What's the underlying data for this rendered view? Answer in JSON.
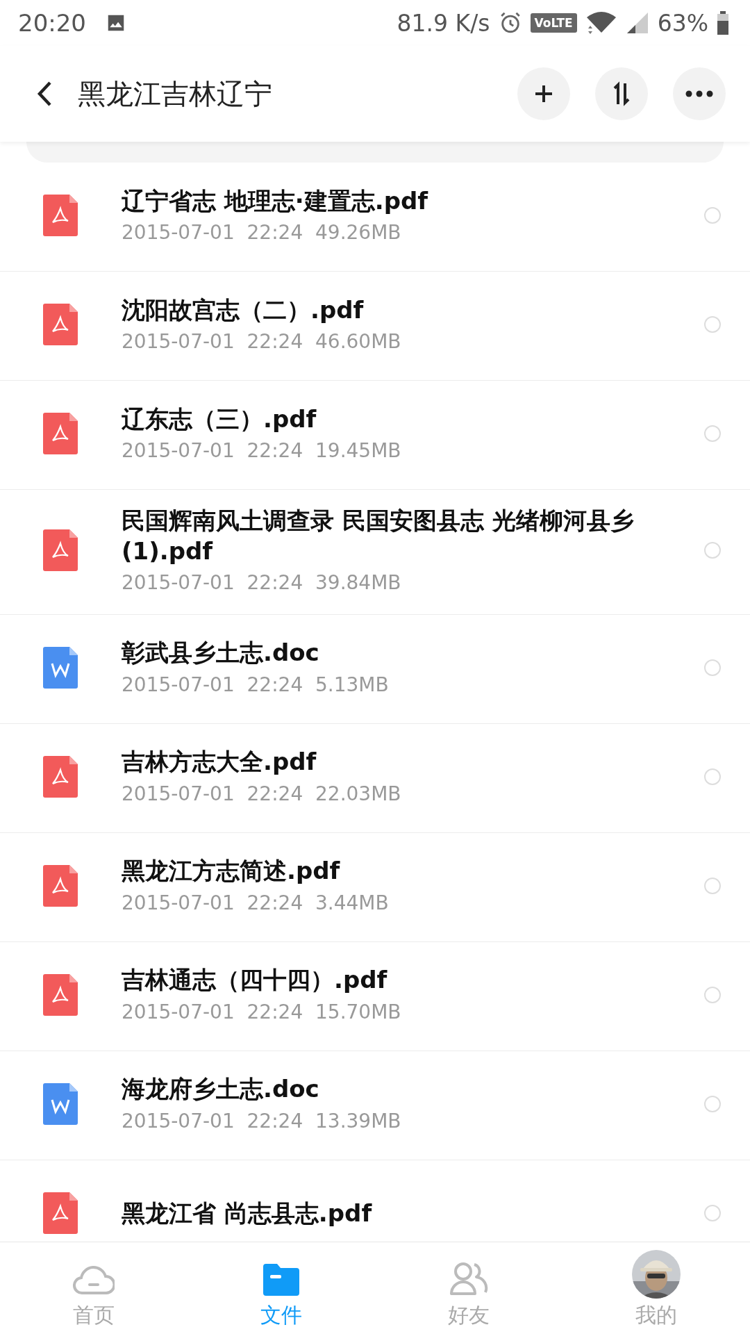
{
  "status_bar": {
    "time": "20:20",
    "speed": "81.9 K/s",
    "volte": "VoLTE",
    "battery": "63%"
  },
  "header": {
    "title": "黑龙江吉林辽宁"
  },
  "files": [
    {
      "kind": "pdf",
      "name": "辽宁省志 地理志·建置志.pdf",
      "meta": "2015-07-01  22:24  49.26MB",
      "selected": false
    },
    {
      "kind": "pdf",
      "name": "沈阳故宫志（二）.pdf",
      "meta": "2015-07-01  22:24  46.60MB",
      "selected": false
    },
    {
      "kind": "pdf",
      "name": "辽东志（三）.pdf",
      "meta": "2015-07-01  22:24  19.45MB",
      "selected": false
    },
    {
      "kind": "pdf",
      "name": "民国辉南风土调查录 民国安图县志 光绪柳河县乡(1).pdf",
      "meta": "2015-07-01  22:24  39.84MB",
      "selected": false
    },
    {
      "kind": "doc",
      "name": "彰武县乡土志.doc",
      "meta": "2015-07-01  22:24  5.13MB",
      "selected": false
    },
    {
      "kind": "pdf",
      "name": "吉林方志大全.pdf",
      "meta": "2015-07-01  22:24  22.03MB",
      "selected": false
    },
    {
      "kind": "pdf",
      "name": "黑龙江方志简述.pdf",
      "meta": "2015-07-01  22:24  3.44MB",
      "selected": false
    },
    {
      "kind": "pdf",
      "name": "吉林通志（四十四）.pdf",
      "meta": "2015-07-01  22:24  15.70MB",
      "selected": false
    },
    {
      "kind": "doc",
      "name": "海龙府乡土志.doc",
      "meta": "2015-07-01  22:24  13.39MB",
      "selected": false
    },
    {
      "kind": "pdf",
      "name": "黑龙江省 尚志县志.pdf",
      "selected": false
    }
  ],
  "tabs": [
    {
      "kind": "home",
      "label": "首页",
      "selected": false
    },
    {
      "kind": "files",
      "label": "文件",
      "selected": true
    },
    {
      "kind": "friends",
      "label": "好友",
      "selected": false
    },
    {
      "kind": "me",
      "label": "我的",
      "selected": false
    }
  ]
}
